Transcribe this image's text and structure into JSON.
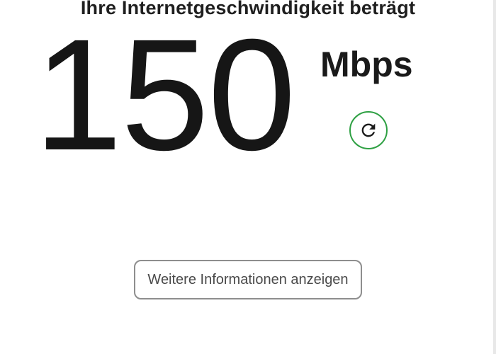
{
  "result": {
    "heading": "Ihre Internetgeschwindigkeit beträgt",
    "speed_value": "150",
    "speed_unit": "Mbps",
    "refresh_icon": "refresh-icon",
    "accent_color": "#2ea043"
  },
  "actions": {
    "more_info_label": "Weitere Informationen anzeigen"
  }
}
